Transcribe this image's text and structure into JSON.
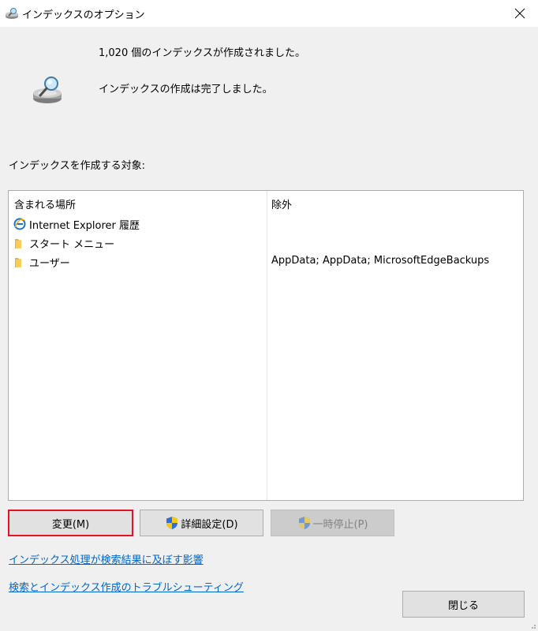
{
  "window": {
    "title": "インデックスのオプション",
    "close_label": "✕"
  },
  "status": {
    "items_indexed": "1,020 個のインデックスが作成されました。",
    "index_state": "インデックスの作成は完了しました。"
  },
  "locations": {
    "section_label": "インデックスを作成する対象:",
    "columns": {
      "included": "含まれる場所",
      "excluded": "除外"
    },
    "rows": [
      {
        "icon": "ie-icon",
        "label": "Internet Explorer 履歴",
        "exclude": ""
      },
      {
        "icon": "folder-icon",
        "label": "スタート メニュー",
        "exclude": ""
      },
      {
        "icon": "folder-icon",
        "label": "ユーザー",
        "exclude": "AppData; AppData; MicrosoftEdgeBackups"
      }
    ]
  },
  "buttons": {
    "modify": "変更(M)",
    "advanced": "詳細設定(D)",
    "pause": "一時停止(P)",
    "close": "閉じる"
  },
  "links": {
    "affect_search": "インデックス処理が検索結果に及ぼす影響",
    "troubleshoot": "検索とインデックス作成のトラブルシューティング"
  },
  "colors": {
    "link": "#0066cc",
    "focus_border": "#e81123",
    "folder": "#f4c542"
  }
}
